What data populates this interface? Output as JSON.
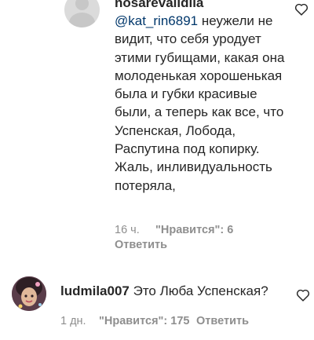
{
  "comment_1": {
    "username": "nosarevalidiia",
    "mention": "@kat_rin6891",
    "text": " неужели не видит, что себя уродует этими губищами, какая она молоденькая хорошенькая была и губки красивые были, а теперь как все, что Успенская, Лобода, Распутина под копирку. Жаль, инливидуальность потеряла,",
    "time": "16 ч.",
    "likes": "\"Нравится\": 6",
    "reply": "Ответить"
  },
  "comment_2": {
    "username": "ludmila007",
    "text": "Это Люба Успенская?",
    "time": "1 дн.",
    "likes": "\"Нравится\": 175",
    "reply": "Ответить"
  }
}
